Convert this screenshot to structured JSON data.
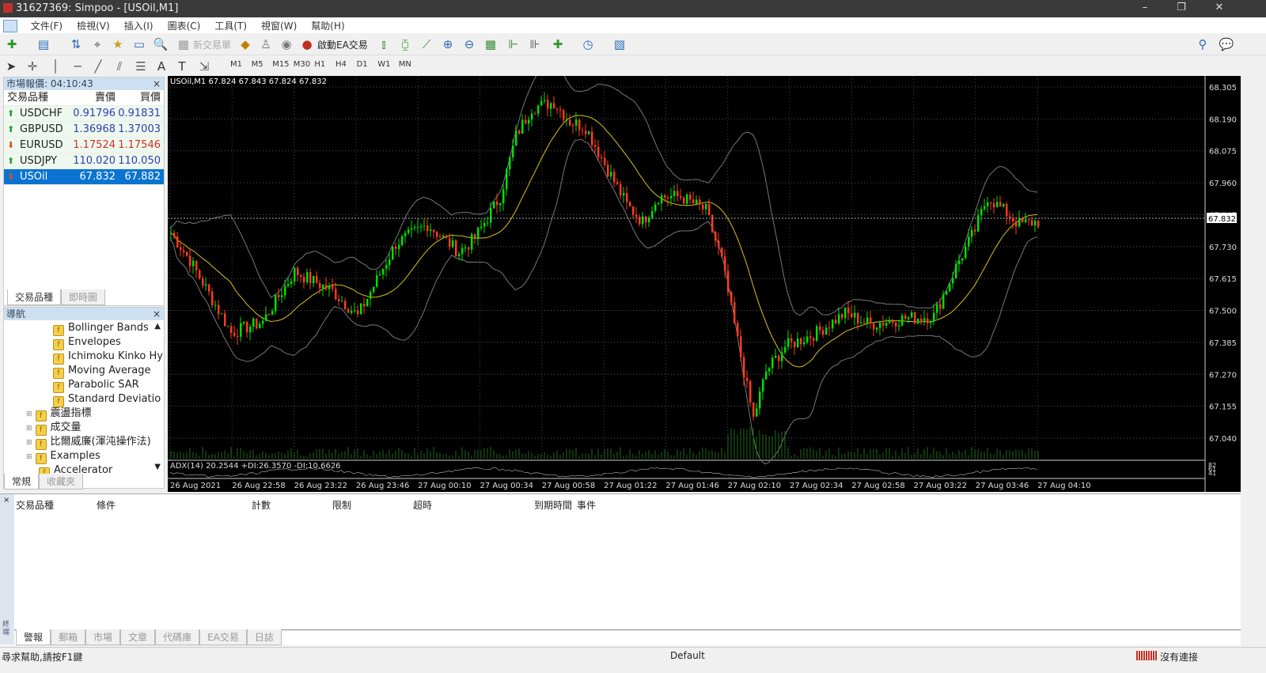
{
  "window": {
    "title": "31627369: Simpoo - [USOil,M1]",
    "minimize": "–",
    "restore": "❐",
    "close": "✕"
  },
  "menu": [
    "文件(F)",
    "檢視(V)",
    "插入(I)",
    "圖表(C)",
    "工具(T)",
    "視窗(W)",
    "幫助(H)"
  ],
  "toolbar": {
    "new_order": "新交易單",
    "auto_trading": "啟動EA交易"
  },
  "timeframes": [
    "M1",
    "M5",
    "M15",
    "M30",
    "H1",
    "H4",
    "D1",
    "W1",
    "MN"
  ],
  "market_watch": {
    "title": "市場報價: 04:10:43",
    "columns": [
      "交易品種",
      "賣價",
      "買價"
    ],
    "rows": [
      {
        "symbol": "USDCHF",
        "bid": "0.91796",
        "ask": "0.91831",
        "dir": "up"
      },
      {
        "symbol": "GBPUSD",
        "bid": "1.36968",
        "ask": "1.37003",
        "dir": "up"
      },
      {
        "symbol": "EURUSD",
        "bid": "1.17524",
        "ask": "1.17546",
        "dir": "down"
      },
      {
        "symbol": "USDJPY",
        "bid": "110.020",
        "ask": "110.050",
        "dir": "up"
      },
      {
        "symbol": "USOil",
        "bid": "67.832",
        "ask": "67.882",
        "dir": "down"
      }
    ],
    "tabs": [
      "交易品種",
      "即時圖"
    ]
  },
  "navigator": {
    "title": "導航",
    "items": [
      "Bollinger Bands",
      "Envelopes",
      "Ichimoku Kinko Hy",
      "Moving Average",
      "Parabolic SAR",
      "Standard Deviatio"
    ],
    "groups": [
      "震盪指標",
      "成交量",
      "比爾威廉(渾沌操作法)",
      "Examples",
      "Accelerator"
    ],
    "tabs": [
      "常規",
      "收藏夾"
    ]
  },
  "chart_data": {
    "type": "candlestick",
    "title": "USOil,M1  67.824 67.843 67.824 67.832",
    "current_price": "67.832",
    "y_ticks": [
      "68.305",
      "68.190",
      "68.075",
      "67.960",
      "67.845",
      "67.730",
      "67.615",
      "67.500",
      "67.385",
      "67.270",
      "67.155",
      "67.040"
    ],
    "ylim": [
      67.02,
      68.33
    ],
    "x_ticks": [
      "26 Aug 2021",
      "26 Aug 22:58",
      "26 Aug 23:22",
      "26 Aug 23:46",
      "27 Aug 00:10",
      "27 Aug 00:34",
      "27 Aug 00:58",
      "27 Aug 01:22",
      "27 Aug 01:46",
      "27 Aug 02:10",
      "27 Aug 02:34",
      "27 Aug 02:58",
      "27 Aug 03:22",
      "27 Aug 03:46",
      "27 Aug 04:10"
    ],
    "price_path": [
      [
        0,
        67.78
      ],
      [
        6,
        67.68
      ],
      [
        19,
        67.42
      ],
      [
        29,
        67.46
      ],
      [
        39,
        67.64
      ],
      [
        51,
        67.57
      ],
      [
        59,
        67.48
      ],
      [
        71,
        67.74
      ],
      [
        81,
        67.81
      ],
      [
        91,
        67.71
      ],
      [
        96,
        67.76
      ],
      [
        104,
        67.91
      ],
      [
        109,
        68.13
      ],
      [
        114,
        68.23
      ],
      [
        121,
        68.25
      ],
      [
        126,
        68.18
      ],
      [
        131,
        68.16
      ],
      [
        136,
        68.05
      ],
      [
        144,
        67.88
      ],
      [
        149,
        67.82
      ],
      [
        154,
        67.91
      ],
      [
        161,
        67.91
      ],
      [
        169,
        67.86
      ],
      [
        174,
        67.68
      ],
      [
        179,
        67.39
      ],
      [
        184,
        67.11
      ],
      [
        188,
        67.28
      ],
      [
        194,
        67.37
      ],
      [
        204,
        67.42
      ],
      [
        213,
        67.49
      ],
      [
        221,
        67.45
      ],
      [
        231,
        67.47
      ],
      [
        241,
        67.48
      ],
      [
        249,
        67.68
      ],
      [
        254,
        67.79
      ],
      [
        258,
        67.91
      ],
      [
        264,
        67.85
      ],
      [
        268,
        67.81
      ],
      [
        274,
        67.82
      ]
    ],
    "adx_label": "ADX(14) 20.2544 +DI:26.3570 -DI:10.6626",
    "adx_ticks": [
      "82",
      "61",
      "41"
    ]
  },
  "terminal": {
    "columns": [
      "交易品種",
      "條件",
      "計數",
      "限制",
      "超時",
      "到期時間",
      "事件"
    ],
    "tabs": [
      "警報",
      "郵箱",
      "市場",
      "文章",
      "代碼庫",
      "EA交易",
      "日誌"
    ],
    "side_label": "終端"
  },
  "status": {
    "help": "尋求幫助,請按F1鍵",
    "profile": "Default",
    "connection": "沒有連接"
  },
  "colors": {
    "bull": "#00e000",
    "bear": "#ff3b1f",
    "selected": "#0a74d0"
  }
}
